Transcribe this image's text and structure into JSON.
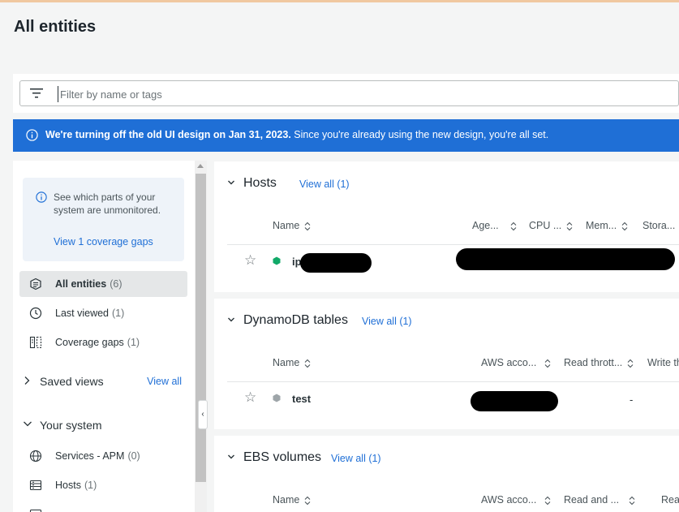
{
  "page": {
    "title": "All entities"
  },
  "filter": {
    "placeholder": "Filter by name or tags"
  },
  "banner": {
    "bold_text": "We're turning off the old UI design on Jan 31, 2023.",
    "text": " Since you're already using the new design, you're all set."
  },
  "sidebar": {
    "gap_card": {
      "text": "See which parts of your system are unmonitored.",
      "link": "View 1 coverage gaps"
    },
    "nav": [
      {
        "label": "All entities",
        "count": "(6)",
        "icon": "entities-icon",
        "active": true
      },
      {
        "label": "Last viewed",
        "count": "(1)",
        "icon": "clock-icon",
        "active": false
      },
      {
        "label": "Coverage gaps",
        "count": "(1)",
        "icon": "coverage-gaps-icon",
        "active": false
      }
    ],
    "saved_views": {
      "label": "Saved views",
      "view_all": "View all"
    },
    "your_system": {
      "label": "Your system",
      "items": [
        {
          "label": "Services - APM",
          "count": "(0)",
          "icon": "globe-icon"
        },
        {
          "label": "Hosts",
          "count": "(1)",
          "icon": "host-icon"
        }
      ]
    }
  },
  "sections": [
    {
      "title": "Hosts",
      "view_all": "View all (1)",
      "columns": [
        "Name",
        "Age...",
        "CPU ...",
        "Mem...",
        "Stora..."
      ],
      "rows": [
        {
          "name": "ip",
          "status": "healthy",
          "status_color": "#11a968"
        }
      ]
    },
    {
      "title": "DynamoDB tables",
      "view_all": "View all (1)",
      "columns": [
        "Name",
        "AWS acco...",
        "Read thrott...",
        "Write th"
      ],
      "rows": [
        {
          "name": "test",
          "status": "unknown",
          "status_color": "#9ea5a9",
          "read_throttled": "-"
        }
      ]
    },
    {
      "title": "EBS volumes",
      "view_all": "View all (1)",
      "columns": [
        "Name",
        "AWS acco...",
        "Read and ...",
        "Rea"
      ],
      "rows": []
    }
  ],
  "colors": {
    "accent": "#1f6fd6",
    "banner_bg": "#1f6fd6",
    "healthy": "#11a968"
  }
}
